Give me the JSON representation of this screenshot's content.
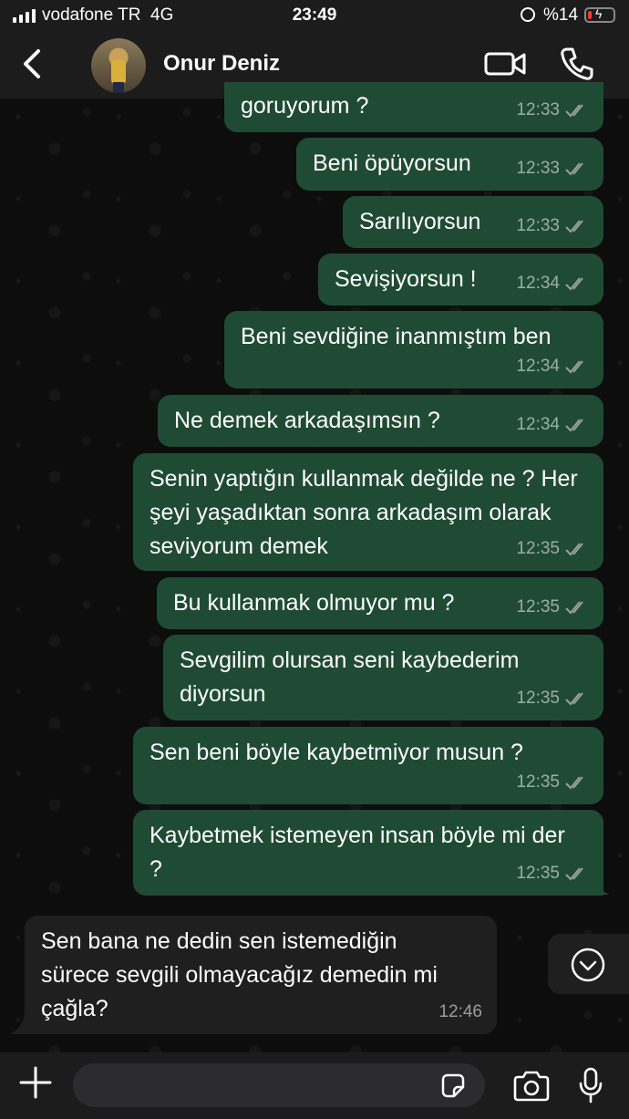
{
  "status_bar": {
    "carrier": "vodafone TR  4G",
    "time": "23:49",
    "battery": "%14",
    "battery_level": 0.14
  },
  "header": {
    "contact_name": "Onur Deniz",
    "icons": [
      "back-chevron-icon",
      "video-call-icon",
      "phone-call-icon"
    ]
  },
  "messages": [
    {
      "text": "goruyorum ?",
      "time": "12:33",
      "direction": "outgoing",
      "status": "read"
    },
    {
      "text": "Beni öpüyorsun",
      "time": "12:33",
      "direction": "outgoing",
      "status": "read"
    },
    {
      "text": "Sarılıyorsun",
      "time": "12:33",
      "direction": "outgoing",
      "status": "read"
    },
    {
      "text": "Sevişiyorsun !",
      "time": "12:34",
      "direction": "outgoing",
      "status": "read"
    },
    {
      "text": "Beni sevdiğine inanmıştım ben",
      "time": "12:34",
      "direction": "outgoing",
      "status": "read"
    },
    {
      "text": "Ne demek arkadaşımsın ?",
      "time": "12:34",
      "direction": "outgoing",
      "status": "read"
    },
    {
      "text": "Senin yaptığın kullanmak değilde ne ? Her şeyi yaşadıktan sonra arkadaşım olarak seviyorum demek",
      "time": "12:35",
      "direction": "outgoing",
      "status": "read"
    },
    {
      "text": "Bu kullanmak olmuyor mu ?",
      "time": "12:35",
      "direction": "outgoing",
      "status": "read"
    },
    {
      "text": "Sevgilim olursan seni kaybederim diyorsun",
      "time": "12:35",
      "direction": "outgoing",
      "status": "read"
    },
    {
      "text": "Sen beni böyle kaybetmiyor musun ?",
      "time": "12:35",
      "direction": "outgoing",
      "status": "read"
    },
    {
      "text": "Kaybetmek istemeyen insan böyle mi der ?",
      "time": "12:35",
      "direction": "outgoing",
      "status": "read"
    },
    {
      "text": "Sen bana ne dedin sen istemediğin sürece sevgili olmayacağız demedin mi çağla?",
      "time": "12:46",
      "direction": "incoming"
    }
  ],
  "composer": {
    "icons": [
      "plus-icon",
      "sticker-icon",
      "camera-icon",
      "microphone-icon"
    ]
  },
  "colors": {
    "outgoing_bubble": "#1f4b34",
    "incoming_bubble": "#1f1f1f",
    "bar_background": "#1c1c1c",
    "battery_low": "#ff3b30"
  }
}
